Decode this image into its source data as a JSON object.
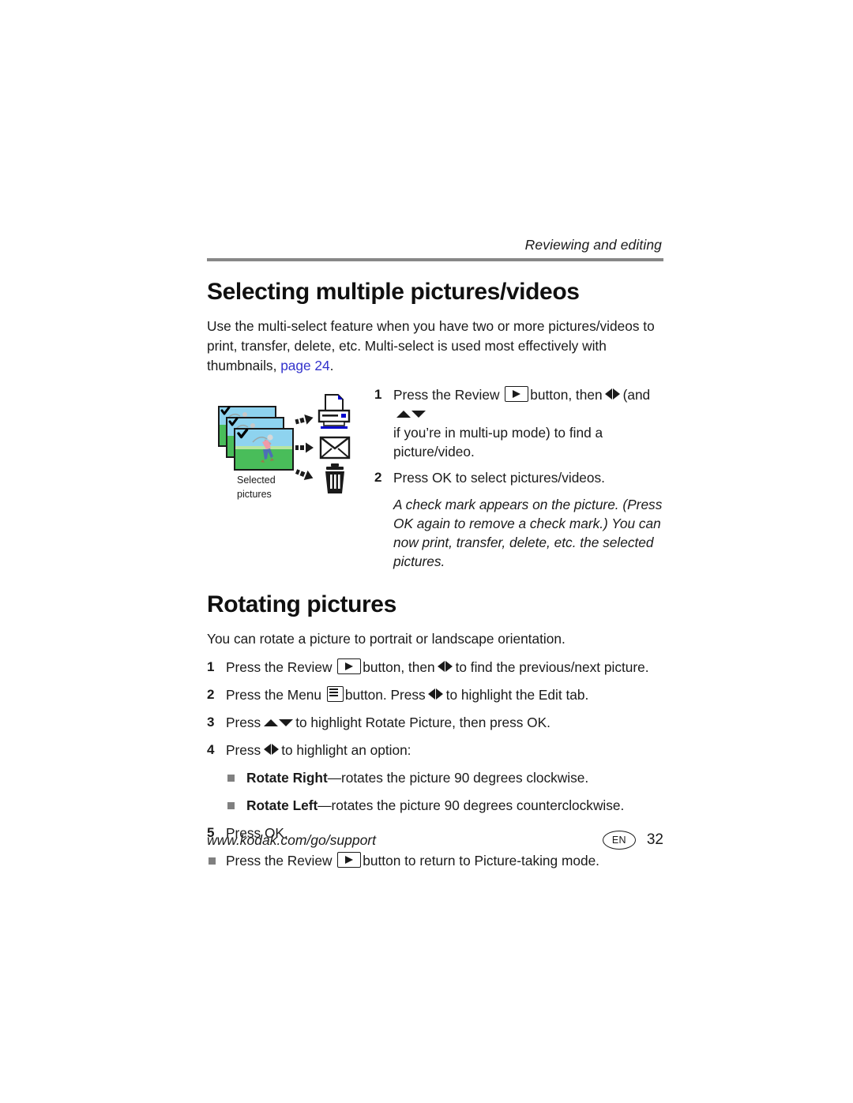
{
  "header": {
    "running_head": "Reviewing and editing"
  },
  "section1": {
    "title": "Selecting multiple pictures/videos",
    "intro_part1": "Use the multi-select feature when you have two or more pictures/videos to print, transfer, delete, etc. Multi-select is used most effectively with thumbnails,",
    "intro_link": "page 24",
    "intro_end": ".",
    "figure": {
      "caption_line1": "Selected",
      "caption_line2": "pictures",
      "icons": [
        "printer-icon",
        "envelope-icon",
        "trash-icon"
      ],
      "thumbnail_count": 3,
      "thumbnail_alt": "golfer swinging a club on green grass with blue sky, check mark overlay"
    },
    "steps": [
      {
        "num": "1",
        "text_a": "Press the Review",
        "text_b": "button, then",
        "text_c": "(and",
        "text_d": "if you’re in multi-up mode) to find a picture/video."
      },
      {
        "num": "2",
        "text_a": "Press OK to select pictures/videos."
      }
    ],
    "note": "A check mark appears on the picture. (Press OK again to remove a check mark.) You can now print, transfer, delete, etc. the selected pictures."
  },
  "section2": {
    "title": "Rotating pictures",
    "intro": "You can rotate a picture to portrait or landscape orientation.",
    "steps": [
      {
        "num": "1",
        "text_a": "Press the Review",
        "text_b": "button, then",
        "text_c": "to find the previous/next picture."
      },
      {
        "num": "2",
        "text_a": "Press the Menu",
        "text_b": "button. Press",
        "text_c": "to highlight the Edit tab."
      },
      {
        "num": "3",
        "text_a": "Press",
        "text_b": "to highlight Rotate Picture, then press OK."
      },
      {
        "num": "4",
        "text_a": "Press",
        "text_b": "to highlight an option:"
      },
      {
        "num": "5",
        "text_a": "Press OK."
      }
    ],
    "options": [
      {
        "label": "Rotate Right",
        "desc": "—rotates the picture 90 degrees clockwise."
      },
      {
        "label": "Rotate Left",
        "desc": "—rotates the picture 90 degrees counterclockwise."
      }
    ],
    "final_bullet": {
      "text_a": "Press the Review",
      "text_b": "button to return to Picture-taking mode."
    }
  },
  "footer": {
    "url": "www.kodak.com/go/support",
    "language_badge": "EN",
    "page_number": "32"
  },
  "colors": {
    "link": "#3333cc",
    "rule": "#878787",
    "bullet": "#808080",
    "printer_accent": "#0000cc",
    "photo_sky": "#6fc6e8",
    "photo_grass": "#3cb54a"
  }
}
